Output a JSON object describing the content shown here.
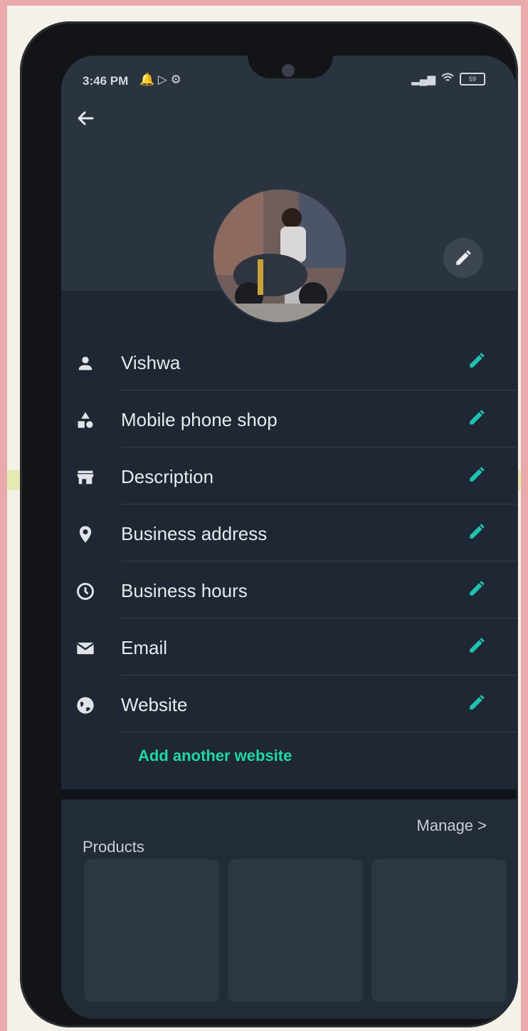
{
  "status_bar": {
    "time": "3:46 PM",
    "icons_left": "🔔 ▷ ⚙",
    "battery": "59"
  },
  "profile": {
    "fields": [
      {
        "label": "Vishwa",
        "icon": "person-icon"
      },
      {
        "label": "Mobile phone shop",
        "icon": "category-icon"
      },
      {
        "label": "Description",
        "icon": "store-icon"
      },
      {
        "label": "Business address",
        "icon": "location-pin-icon"
      },
      {
        "label": "Business hours",
        "icon": "clock-icon"
      },
      {
        "label": "Email",
        "icon": "email-icon"
      },
      {
        "label": "Website",
        "icon": "globe-icon"
      }
    ],
    "add_website": "Add another website"
  },
  "products": {
    "title": "Products",
    "manage": "Manage >"
  },
  "colors": {
    "accent": "#1fd6a8",
    "background": "#1e2733",
    "text": "#e7eaee"
  }
}
